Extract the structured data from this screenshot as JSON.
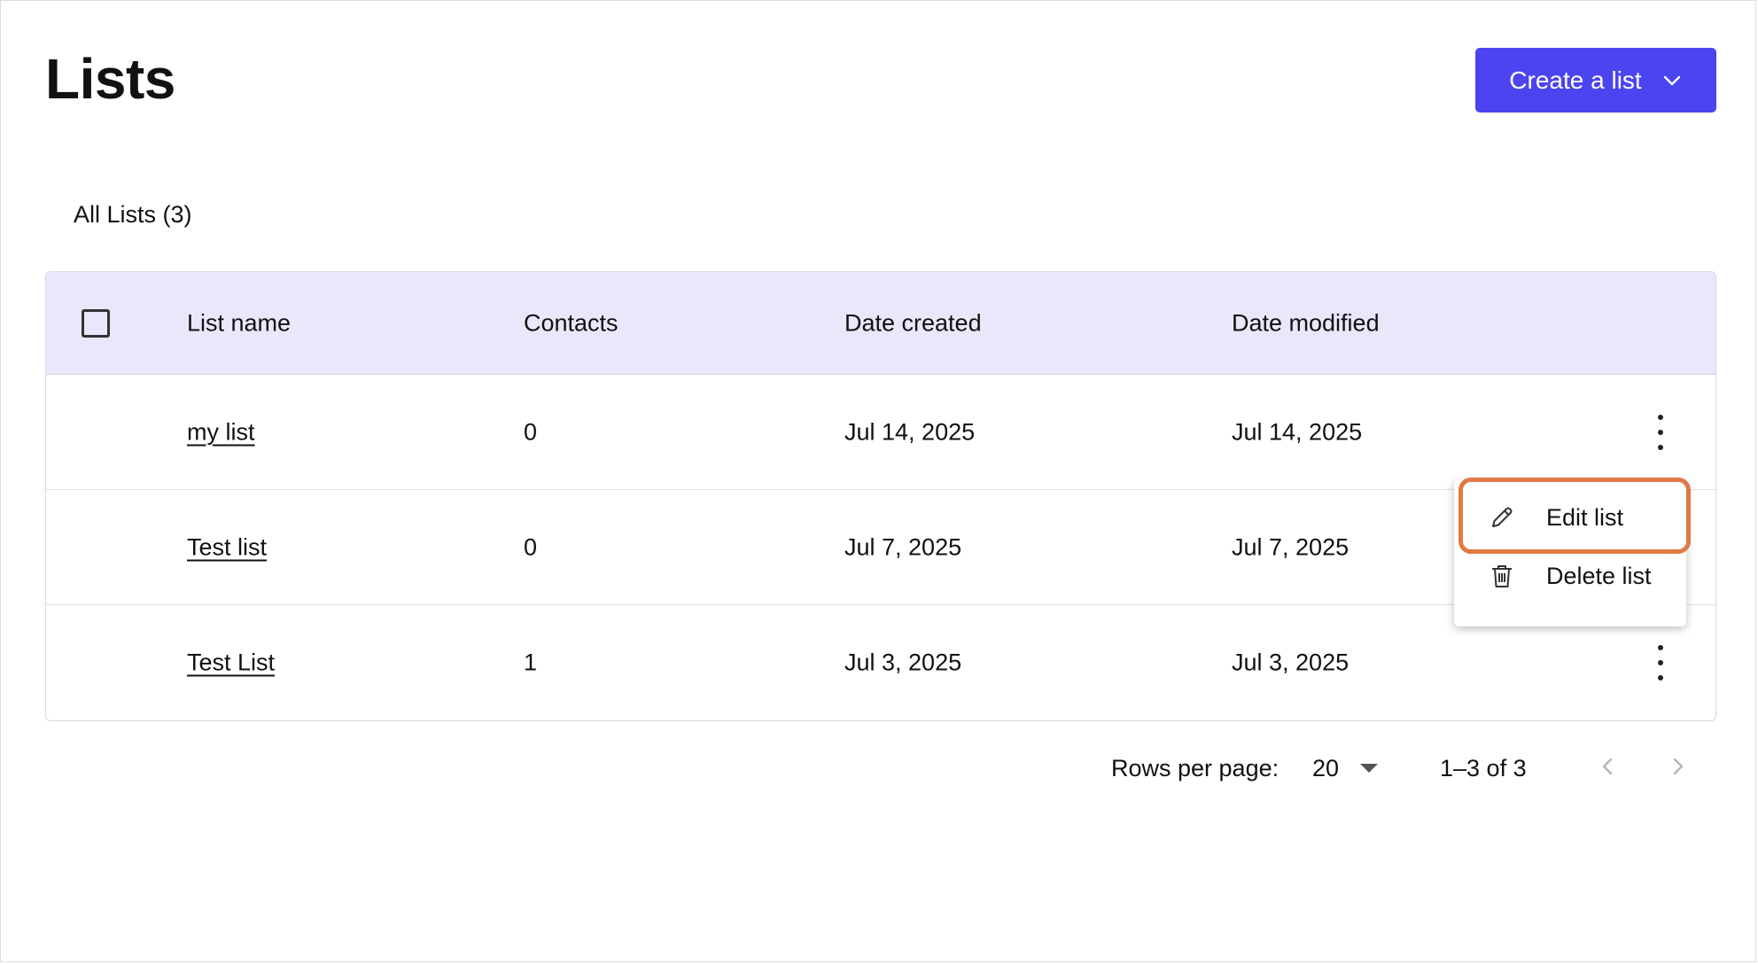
{
  "header": {
    "title": "Lists",
    "create_button_label": "Create a list"
  },
  "tab": {
    "label": "All Lists (3)"
  },
  "table": {
    "columns": [
      "List name",
      "Contacts",
      "Date created",
      "Date modified"
    ],
    "rows": [
      {
        "name": "my list",
        "contacts": "0",
        "created": "Jul 14, 2025",
        "modified": "Jul 14, 2025"
      },
      {
        "name": "Test list",
        "contacts": "0",
        "created": "Jul 7, 2025",
        "modified": "Jul 7, 2025"
      },
      {
        "name": "Test List",
        "contacts": "1",
        "created": "Jul 3, 2025",
        "modified": "Jul 3, 2025"
      }
    ]
  },
  "row_menu": {
    "items": [
      {
        "label": "Edit list",
        "icon": "pencil-icon"
      },
      {
        "label": "Delete list",
        "icon": "trash-icon"
      }
    ]
  },
  "pagination": {
    "rows_per_page_label": "Rows per page:",
    "rows_per_page_value": "20",
    "range_text": "1–3 of 3"
  },
  "colors": {
    "accent": "#4b44f1",
    "header_bg": "#e9e8fb",
    "highlight": "#e07a45"
  }
}
